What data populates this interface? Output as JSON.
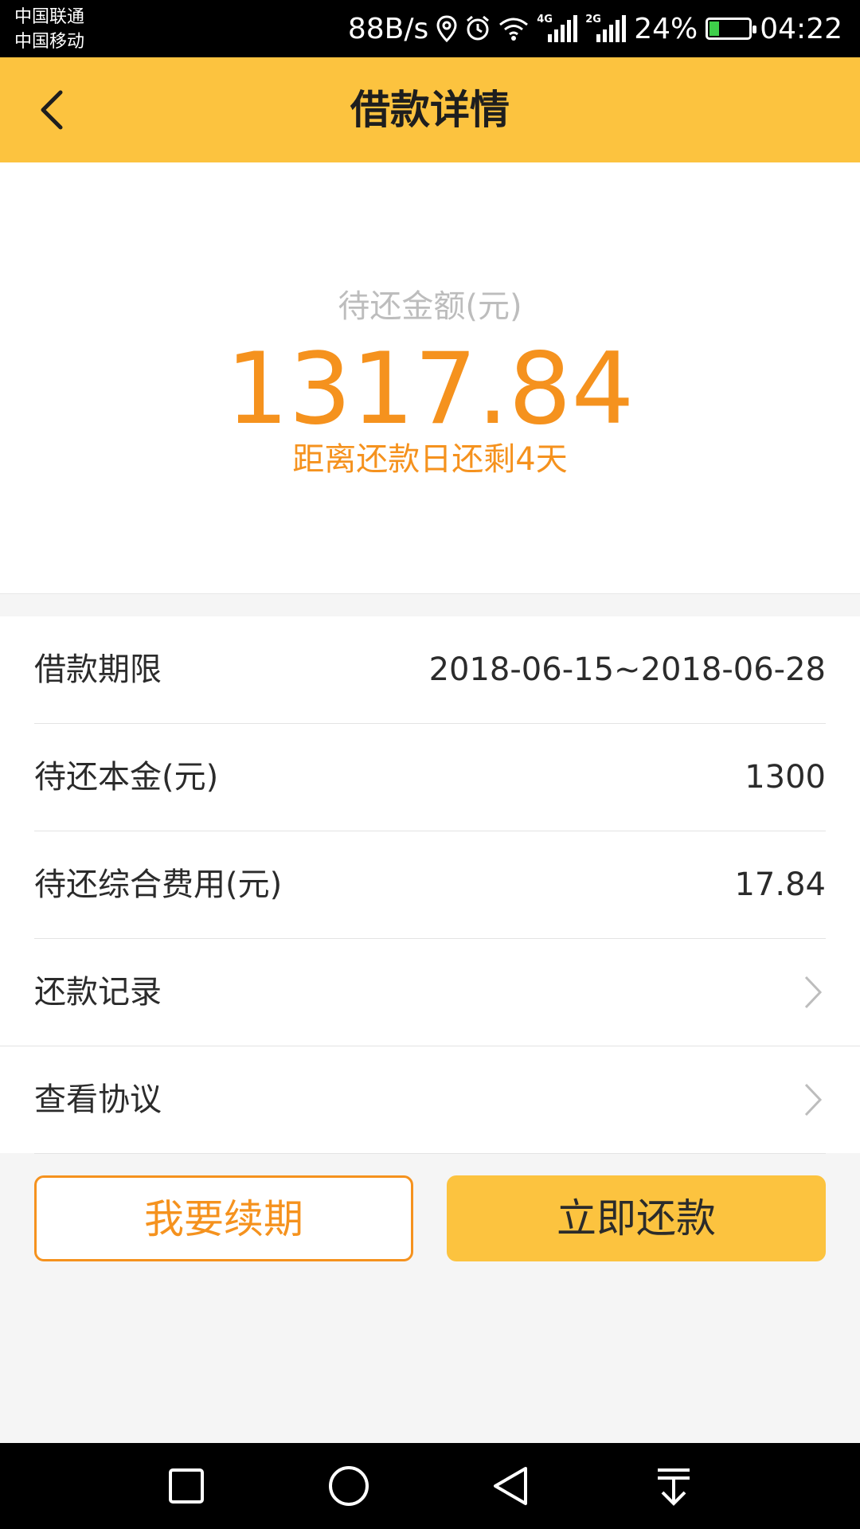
{
  "status_bar": {
    "carrier_1": "中国联通",
    "carrier_2": "中国移动",
    "net_speed": "88B/s",
    "signal_1_tag": "4G",
    "signal_2_tag": "2G",
    "battery_percent": "24%",
    "time": "04:22"
  },
  "header": {
    "title": "借款详情",
    "back_icon": "chevron-left-icon"
  },
  "summary": {
    "label": "待还金额(元)",
    "amount": "1317.84",
    "due_note": "距离还款日还剩4天"
  },
  "details": {
    "rows": [
      {
        "label": "借款期限",
        "value": "2018-06-15~2018-06-28"
      },
      {
        "label": "待还本金(元)",
        "value": "1300"
      },
      {
        "label": "待还综合费用(元)",
        "value": "17.84"
      },
      {
        "label": "还款记录",
        "icon": "chevron-right-icon"
      },
      {
        "label": "查看协议",
        "icon": "chevron-right-icon"
      }
    ]
  },
  "actions": {
    "renew_label": "我要续期",
    "repay_label": "立即还款"
  },
  "colors": {
    "accent_yellow": "#fcc33f",
    "accent_orange": "#f5921e"
  },
  "nav_bar": {
    "icons": [
      "square-recents-icon",
      "circle-home-icon",
      "triangle-back-icon",
      "pull-down-icon"
    ]
  }
}
